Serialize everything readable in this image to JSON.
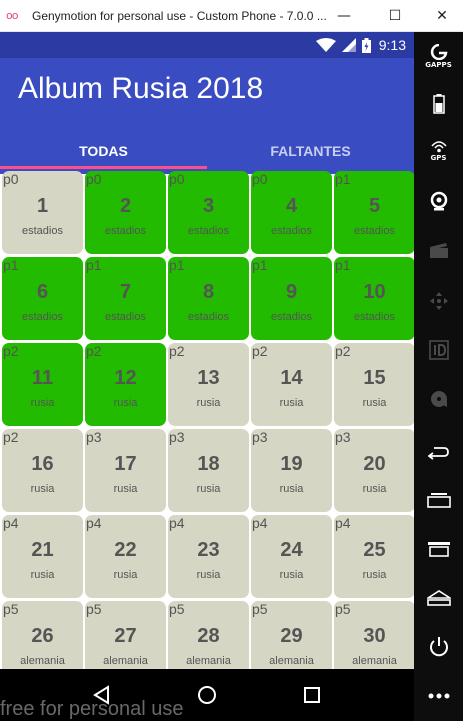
{
  "window": {
    "logo": "oo",
    "title": "Genymotion for personal use - Custom Phone - 7.0.0 ...",
    "minimize_label": "—",
    "maximize_label": "☐",
    "close_label": "✕"
  },
  "statusbar": {
    "time": "9:13",
    "icons": [
      "wifi-icon",
      "signal-icon",
      "battery-icon"
    ]
  },
  "app": {
    "title": "Album Rusia 2018",
    "tabs": [
      {
        "label": "TODAS",
        "selected": true
      },
      {
        "label": "FALTANTES",
        "selected": false
      }
    ]
  },
  "colors": {
    "have": "#22bb00",
    "missing": "#d6d6c4",
    "appbar": "#3a4cc1",
    "statusbar": "#2c3aa3",
    "indicator": "#ff4f8b"
  },
  "stickers": [
    {
      "group": "p0",
      "number": "1",
      "team": "estadios",
      "have": false
    },
    {
      "group": "p0",
      "number": "2",
      "team": "estadios",
      "have": true
    },
    {
      "group": "p0",
      "number": "3",
      "team": "estadios",
      "have": true
    },
    {
      "group": "p0",
      "number": "4",
      "team": "estadios",
      "have": true
    },
    {
      "group": "p1",
      "number": "5",
      "team": "estadios",
      "have": true
    },
    {
      "group": "p1",
      "number": "6",
      "team": "estadios",
      "have": true
    },
    {
      "group": "p1",
      "number": "7",
      "team": "estadios",
      "have": true
    },
    {
      "group": "p1",
      "number": "8",
      "team": "estadios",
      "have": true
    },
    {
      "group": "p1",
      "number": "9",
      "team": "estadios",
      "have": true
    },
    {
      "group": "p1",
      "number": "10",
      "team": "estadios",
      "have": true
    },
    {
      "group": "p2",
      "number": "11",
      "team": "rusia",
      "have": true
    },
    {
      "group": "p2",
      "number": "12",
      "team": "rusia",
      "have": true
    },
    {
      "group": "p2",
      "number": "13",
      "team": "rusia",
      "have": false
    },
    {
      "group": "p2",
      "number": "14",
      "team": "rusia",
      "have": false
    },
    {
      "group": "p2",
      "number": "15",
      "team": "rusia",
      "have": false
    },
    {
      "group": "p2",
      "number": "16",
      "team": "rusia",
      "have": false
    },
    {
      "group": "p3",
      "number": "17",
      "team": "rusia",
      "have": false
    },
    {
      "group": "p3",
      "number": "18",
      "team": "rusia",
      "have": false
    },
    {
      "group": "p3",
      "number": "19",
      "team": "rusia",
      "have": false
    },
    {
      "group": "p3",
      "number": "20",
      "team": "rusia",
      "have": false
    },
    {
      "group": "p4",
      "number": "21",
      "team": "rusia",
      "have": false
    },
    {
      "group": "p4",
      "number": "22",
      "team": "rusia",
      "have": false
    },
    {
      "group": "p4",
      "number": "23",
      "team": "rusia",
      "have": false
    },
    {
      "group": "p4",
      "number": "24",
      "team": "rusia",
      "have": false
    },
    {
      "group": "p4",
      "number": "25",
      "team": "rusia",
      "have": false
    },
    {
      "group": "p5",
      "number": "26",
      "team": "alemania",
      "have": false
    },
    {
      "group": "p5",
      "number": "27",
      "team": "alemania",
      "have": false
    },
    {
      "group": "p5",
      "number": "28",
      "team": "alemania",
      "have": false
    },
    {
      "group": "p5",
      "number": "29",
      "team": "alemania",
      "have": false
    },
    {
      "group": "p5",
      "number": "30",
      "team": "alemania",
      "have": false
    }
  ],
  "navbar": {
    "buttons": [
      "back-icon",
      "home-icon",
      "recents-icon"
    ]
  },
  "watermark": "free for personal use",
  "sidebar": {
    "gapps_label": "GAPPS",
    "gps_label": "GPS",
    "buttons": [
      "gapps-icon",
      "battery-icon",
      "gps-icon",
      "webcam-icon",
      "capture-icon",
      "dpad-icon",
      "device-id-icon",
      "disk-icon",
      "back-icon",
      "recents-icon",
      "menu-icon",
      "home-icon",
      "power-icon",
      "more-icon"
    ]
  }
}
